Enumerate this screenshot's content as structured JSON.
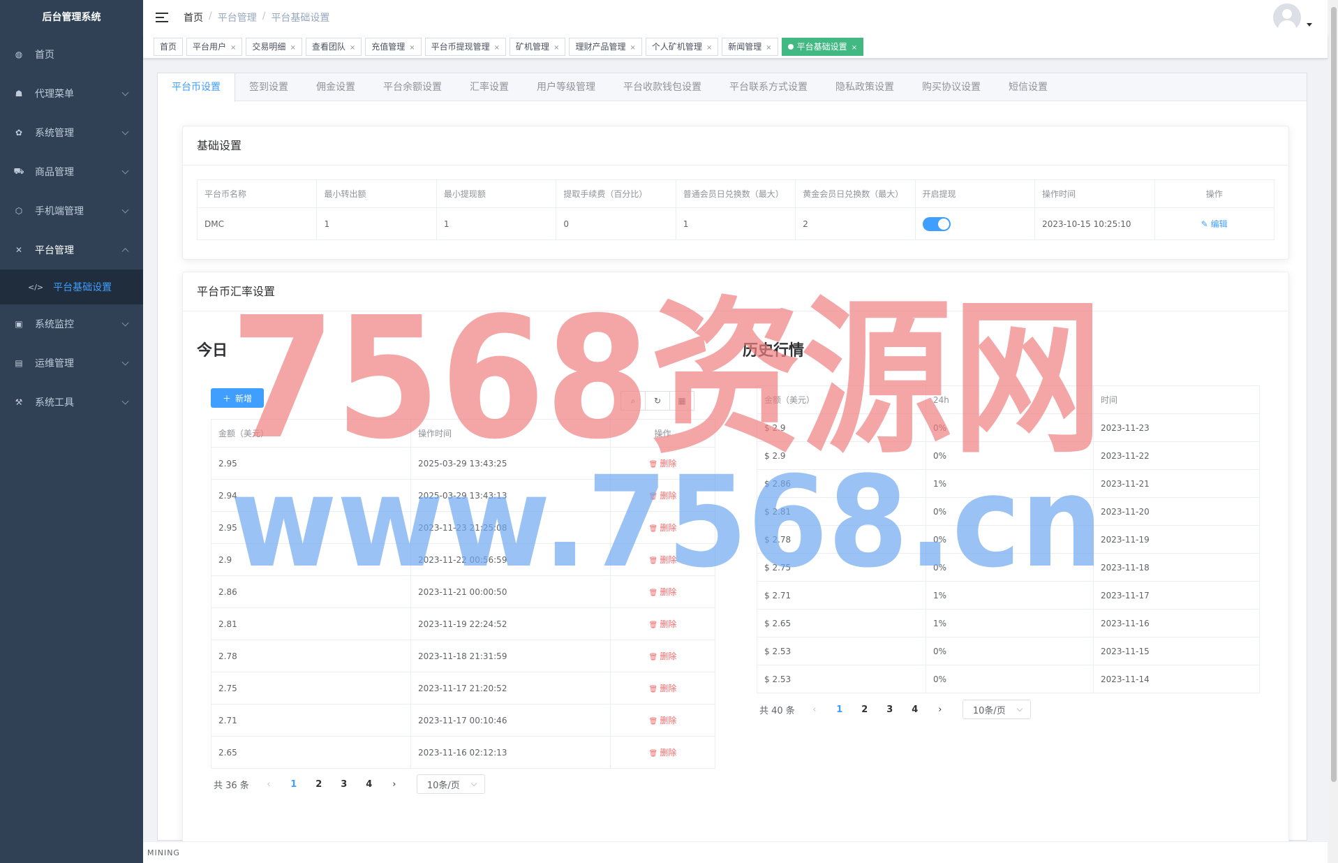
{
  "sidebar": {
    "logo": "后台管理系统",
    "items": [
      {
        "label": "首页",
        "icon": "dashboard-icon"
      },
      {
        "label": "代理菜单",
        "icon": "user-icon"
      },
      {
        "label": "系统管理",
        "icon": "gear-icon"
      },
      {
        "label": "商品管理",
        "icon": "cart-icon"
      },
      {
        "label": "手机端管理",
        "icon": "cube-icon"
      },
      {
        "label": "平台管理",
        "icon": "tools-icon"
      },
      {
        "label": "系统监控",
        "icon": "monitor-icon"
      },
      {
        "label": "运维管理",
        "icon": "server-icon"
      },
      {
        "label": "系统工具",
        "icon": "wrench-icon"
      }
    ],
    "active_sub": "平台基础设置"
  },
  "breadcrumb": [
    "首页",
    "平台管理",
    "平台基础设置"
  ],
  "tags": [
    "首页",
    "平台用户",
    "交易明细",
    "查看团队",
    "充值管理",
    "平台币提现管理",
    "矿机管理",
    "理财产品管理",
    "个人矿机管理",
    "新闻管理",
    "平台基础设置"
  ],
  "tabs": [
    "平台币设置",
    "签到设置",
    "佣金设置",
    "平台余额设置",
    "汇率设置",
    "用户等级管理",
    "平台收款钱包设置",
    "平台联系方式设置",
    "隐私政策设置",
    "购买协议设置",
    "短信设置"
  ],
  "basic": {
    "title": "基础设置",
    "headers": [
      "平台币名称",
      "最小转出额",
      "最小提现额",
      "提取手续费（百分比）",
      "普通会员日兑换数（最大）",
      "黄金会员日兑换数（最大）",
      "开启提现",
      "操作时间",
      "操作"
    ],
    "row": {
      "name": "DMC",
      "min_out": "1",
      "min_withdraw": "1",
      "fee": "0",
      "normal_max": "1",
      "gold_max": "2",
      "withdraw_enabled": true,
      "time": "2023-10-15 10:25:10",
      "action": "编辑"
    }
  },
  "rate": {
    "title": "平台币汇率设置",
    "today_title": "今日",
    "history_title": "历史行情",
    "add_label": "新增",
    "today_headers": [
      "金额（美元）",
      "操作时间",
      "操作"
    ],
    "today_rows": [
      [
        "2.95",
        "2025-03-29 13:43:25"
      ],
      [
        "2.94",
        "2025-03-29 13:43:13"
      ],
      [
        "2.95",
        "2023-11-23 21:25:08"
      ],
      [
        "2.9",
        "2023-11-22 00:56:59"
      ],
      [
        "2.86",
        "2023-11-21 00:00:50"
      ],
      [
        "2.81",
        "2023-11-19 22:24:52"
      ],
      [
        "2.78",
        "2023-11-18 21:31:59"
      ],
      [
        "2.75",
        "2023-11-17 21:20:52"
      ],
      [
        "2.71",
        "2023-11-17 00:10:46"
      ],
      [
        "2.65",
        "2023-11-16 02:12:13"
      ]
    ],
    "delete_label": "删除",
    "today_total": "共 36 条",
    "history_headers": [
      "金额（美元）",
      "24h",
      "时间"
    ],
    "history_rows": [
      [
        "$ 2.9",
        "0%",
        "2023-11-23"
      ],
      [
        "$ 2.9",
        "0%",
        "2023-11-22"
      ],
      [
        "$ 2.86",
        "1%",
        "2023-11-21"
      ],
      [
        "$ 2.81",
        "0%",
        "2023-11-20"
      ],
      [
        "$ 2.78",
        "0%",
        "2023-11-19"
      ],
      [
        "$ 2.75",
        "0%",
        "2023-11-18"
      ],
      [
        "$ 2.71",
        "1%",
        "2023-11-17"
      ],
      [
        "$ 2.65",
        "1%",
        "2023-11-16"
      ],
      [
        "$ 2.53",
        "0%",
        "2023-11-15"
      ],
      [
        "$ 2.53",
        "0%",
        "2023-11-14"
      ]
    ],
    "history_total": "共 40 条",
    "pages": [
      "1",
      "2",
      "3",
      "4"
    ],
    "page_size": "10条/页"
  },
  "footer": "MINING",
  "watermark": {
    "line1": "7568资源网",
    "line2": "www.7568.cn",
    "color1": "#f08080",
    "color2": "#6fa8f0"
  },
  "colors": {
    "sidebar": "#304156",
    "primary": "#409eff",
    "active_tag": "#42b983",
    "danger": "#f56c6c"
  }
}
